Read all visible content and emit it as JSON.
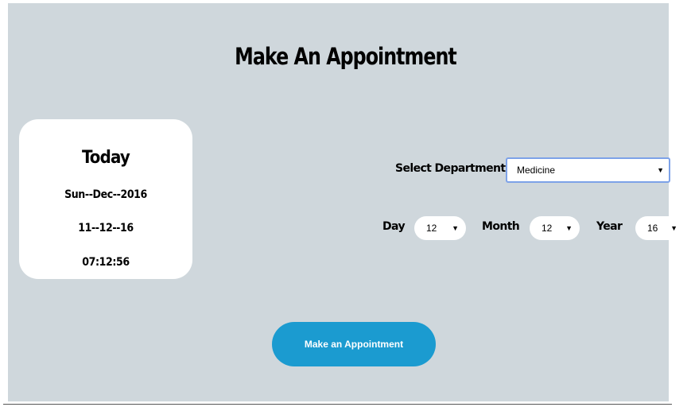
{
  "page": {
    "title": "Make An Appointment"
  },
  "today": {
    "heading": "Today",
    "day_month_year": "Sun--Dec--2016",
    "date_short": "11--12--16",
    "time": "07:12:56"
  },
  "department": {
    "label": "Select Department",
    "selected": "Medicine"
  },
  "date_picker": {
    "day_label": "Day",
    "day_value": "12",
    "month_label": "Month",
    "month_value": "12",
    "year_label": "Year",
    "year_value": "16"
  },
  "actions": {
    "submit_label": "Make an Appointment"
  },
  "icons": {
    "dropdown": "caret-down-icon",
    "caret_glyph": "▼"
  },
  "colors": {
    "panel_bg": "#cfd7dc",
    "card_bg": "#ffffff",
    "button_bg": "#1b9bd0",
    "focus_border": "#7da2e8"
  }
}
